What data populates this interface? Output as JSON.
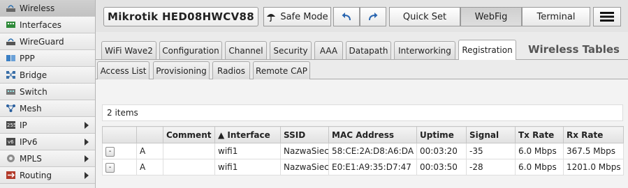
{
  "sidebar": {
    "items": [
      {
        "label": "Wireless",
        "icon": "wireless-icon",
        "arrow": false,
        "active": true
      },
      {
        "label": "Interfaces",
        "icon": "interfaces-icon",
        "arrow": false,
        "active": false
      },
      {
        "label": "WireGuard",
        "icon": "wireguard-icon",
        "arrow": false,
        "active": false
      },
      {
        "label": "PPP",
        "icon": "ppp-icon",
        "arrow": false,
        "active": false
      },
      {
        "label": "Bridge",
        "icon": "bridge-icon",
        "arrow": false,
        "active": false
      },
      {
        "label": "Switch",
        "icon": "switch-icon",
        "arrow": false,
        "active": false
      },
      {
        "label": "Mesh",
        "icon": "mesh-icon",
        "arrow": false,
        "active": false
      },
      {
        "label": "IP",
        "icon": "ip-icon",
        "arrow": true,
        "active": false
      },
      {
        "label": "IPv6",
        "icon": "ipv6-icon",
        "arrow": true,
        "active": false
      },
      {
        "label": "MPLS",
        "icon": "mpls-icon",
        "arrow": true,
        "active": false
      },
      {
        "label": "Routing",
        "icon": "routing-icon",
        "arrow": true,
        "active": false
      }
    ]
  },
  "header": {
    "device_title": "Mikrotik HED08HWCV88",
    "safe_mode": "Safe Mode",
    "quick_set": "Quick Set",
    "webfig": "WebFig",
    "terminal": "Terminal"
  },
  "tabs": {
    "row1": [
      "WiFi Wave2",
      "Configuration",
      "Channel",
      "Security",
      "AAA",
      "Datapath",
      "Interworking",
      "Registration"
    ],
    "row2": [
      "Access List",
      "Provisioning",
      "Radios",
      "Remote CAP"
    ],
    "active": "Registration"
  },
  "page_title": "Wireless Tables",
  "item_count": "2 items",
  "table": {
    "columns": [
      "",
      "",
      "Comment",
      "▲ Interface",
      "SSID",
      "MAC Address",
      "Uptime",
      "Signal",
      "Tx Rate",
      "Rx Rate"
    ],
    "rows": [
      {
        "btn": "-",
        "flag": "A",
        "comment": "",
        "interface": "wifi1",
        "ssid": "NazwaSieci",
        "mac": "58:CE:2A:D8:A6:DA",
        "uptime": "00:03:20",
        "signal": "-35",
        "tx": "6.0 Mbps",
        "rx": "367.5 Mbps"
      },
      {
        "btn": "-",
        "flag": "A",
        "comment": "",
        "interface": "wifi1",
        "ssid": "NazwaSieci",
        "mac": "E0:E1:A9:35:D7:47",
        "uptime": "00:03:50",
        "signal": "-28",
        "tx": "6.0 Mbps",
        "rx": "1201.0 Mbps"
      }
    ]
  }
}
